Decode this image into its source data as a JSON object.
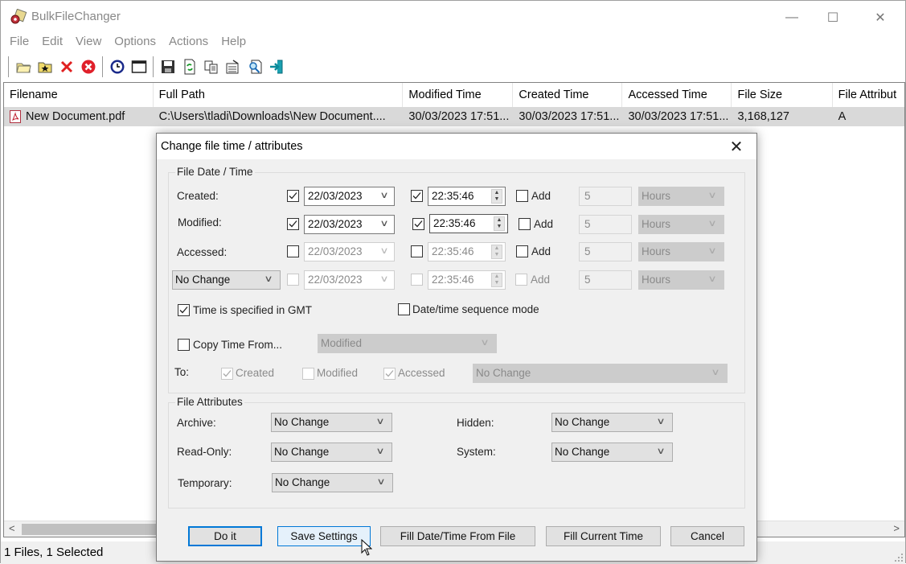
{
  "window": {
    "title": "BulkFileChanger",
    "controls": {
      "minimize": "—",
      "maximize": "☐",
      "close": "✕"
    }
  },
  "menu": [
    "File",
    "Edit",
    "View",
    "Options",
    "Actions",
    "Help"
  ],
  "toolbar": [
    {
      "icon": "open-folder-icon"
    },
    {
      "icon": "add-folder-icon"
    },
    {
      "icon": "delete-icon"
    },
    {
      "icon": "clear-all-icon"
    },
    {
      "icon": "clock-icon"
    },
    {
      "icon": "window-icon"
    },
    {
      "icon": "save-icon"
    },
    {
      "icon": "refresh-icon"
    },
    {
      "icon": "copy-icon"
    },
    {
      "icon": "properties-icon"
    },
    {
      "icon": "find-icon"
    },
    {
      "icon": "exit-icon"
    }
  ],
  "list": {
    "columns": [
      "Filename",
      "Full Path",
      "Modified Time",
      "Created Time",
      "Accessed Time",
      "File Size",
      "File Attribut"
    ],
    "rows": [
      {
        "filename": "New Document.pdf",
        "full_path": "C:\\Users\\tladi\\Downloads\\New Document....",
        "modified": "30/03/2023 17:51...",
        "created": "30/03/2023 17:51...",
        "accessed": "30/03/2023 17:51...",
        "size": "3,168,127",
        "attributes": "A"
      }
    ],
    "scroll_left": "<",
    "scroll_right": ">"
  },
  "status": "1 Files, 1 Selected",
  "dialog": {
    "title": "Change file time / attributes",
    "close": "✕",
    "date_group": "File Date / Time",
    "rows": [
      {
        "label": "Created:",
        "date_checked": true,
        "date": "22/03/2023",
        "time_checked": true,
        "time": "22:35:46",
        "add_checked": false,
        "add_label": "Add",
        "amount": "5",
        "unit": "Hours"
      },
      {
        "label": "Modified:",
        "date_checked": true,
        "date": "22/03/2023",
        "time_checked": true,
        "time": "22:35:46",
        "add_checked": false,
        "add_label": "Add",
        "amount": "5",
        "unit": "Hours"
      },
      {
        "label": "Accessed:",
        "date_checked": false,
        "date": "22/03/2023",
        "time_checked": false,
        "time": "22:35:46",
        "add_checked": false,
        "add_label": "Add",
        "amount": "5",
        "unit": "Hours"
      },
      {
        "label": "No Change",
        "date_checked": false,
        "date": "22/03/2023",
        "time_checked": false,
        "time": "22:35:46",
        "add_checked": false,
        "add_label": "Add",
        "amount": "5",
        "unit": "Hours"
      }
    ],
    "gmt_label": "Time is specified in GMT",
    "gmt_checked": true,
    "sequence_label": "Date/time sequence mode",
    "sequence_checked": false,
    "copy_label": "Copy Time From...",
    "copy_checked": false,
    "copy_source": "Modified",
    "to_label": "To:",
    "to_created": "Created",
    "to_created_checked": true,
    "to_modified": "Modified",
    "to_modified_checked": false,
    "to_accessed": "Accessed",
    "to_accessed_checked": true,
    "to_mode": "No Change",
    "attr_group": "File Attributes",
    "attrs": {
      "archive_label": "Archive:",
      "archive": "No Change",
      "readonly_label": "Read-Only:",
      "readonly": "No Change",
      "temporary_label": "Temporary:",
      "temporary": "No Change",
      "hidden_label": "Hidden:",
      "hidden": "No Change",
      "system_label": "System:",
      "system": "No Change"
    },
    "buttons": {
      "do_it": "Do it",
      "save_settings": "Save Settings",
      "fill_from_file": "Fill Date/Time From File",
      "fill_current": "Fill Current Time",
      "cancel": "Cancel"
    }
  },
  "colors": {
    "accent": "#0078d7",
    "selected_row": "#d9d9d9",
    "dialog_bg": "#f0f0f0"
  }
}
